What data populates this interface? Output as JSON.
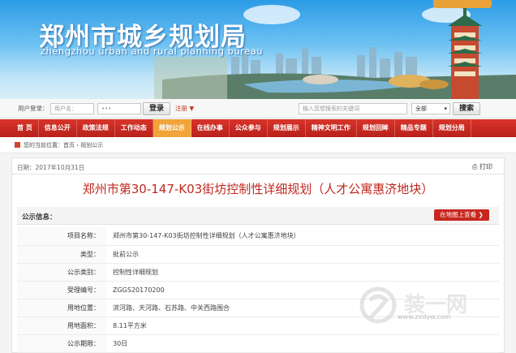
{
  "header": {
    "title": "郑州市城乡规划局",
    "subtitle": "zhengzhou urban and rural planning bureau"
  },
  "toolbar": {
    "login_label": "用户登录：",
    "username_placeholder": "用户名：",
    "password_placeholder": "•••",
    "login_button": "登录",
    "register_label": "注册 ▼",
    "search_placeholder": "输入您想搜索的关键词",
    "scope_select": "全部",
    "search_button": "搜索"
  },
  "nav": {
    "items": [
      "首 页",
      "信息公开",
      "政策法规",
      "工作动态",
      "规划公示",
      "在线办事",
      "公众参与",
      "规划展示",
      "精神文明工作",
      "规划回眸",
      "精品专题",
      "规划分局"
    ],
    "active_index": 4
  },
  "breadcrumb": {
    "text": "您的当前位置：首页 › 规划公示"
  },
  "article": {
    "date": "日期：2017年10月31日",
    "print_label": "打印",
    "title": "郑州市第30-147-K03街坊控制性详细规划（人才公寓惠济地块）",
    "info_label": "公示信息：",
    "map_button": "在地图上查看 ❯",
    "rows": [
      {
        "key": "项目名称：",
        "value": "郑州市第30-147-K03街坊控制性详细规划（人才公寓惠济地块）"
      },
      {
        "key": "类型：",
        "value": "批前公示"
      },
      {
        "key": "公示类别：",
        "value": "控制性详细规划"
      },
      {
        "key": "受理编号：",
        "value": "ZGGS20170200"
      },
      {
        "key": "用地位置：",
        "value": "滨河路、天河路、石苏路、中关西路围合"
      },
      {
        "key": "用地面积：",
        "value": "8.11平方米"
      },
      {
        "key": "公示期限：",
        "value": "30日"
      }
    ]
  },
  "watermark": {
    "text": "www.zxdyw.com"
  },
  "colors": {
    "nav_red": "#c7271f",
    "nav_active": "#f0a43a",
    "title_red": "#c0281f"
  }
}
